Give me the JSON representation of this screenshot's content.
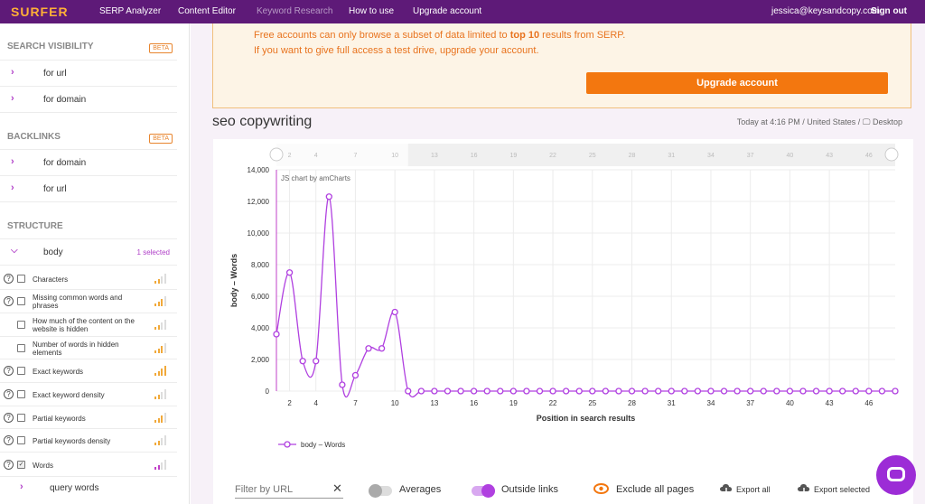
{
  "nav": {
    "logo": "SURFER",
    "items": [
      "SERP Analyzer",
      "Content Editor",
      "Keyword Research",
      "How to use",
      "Upgrade account"
    ],
    "email": "jessica@keysandcopy.com",
    "signout": "Sign out"
  },
  "sidebar": {
    "visibility": {
      "title": "SEARCH VISIBILITY",
      "badge": "BETA",
      "items": [
        "for url",
        "for domain"
      ]
    },
    "backlinks": {
      "title": "BACKLINKS",
      "badge": "BETA",
      "items": [
        "for domain",
        "for url"
      ]
    },
    "structure": {
      "title": "STRUCTURE",
      "group": "body",
      "group_count": "1 selected",
      "metrics": [
        "Characters",
        "Missing common words and phrases",
        "How much of the content on the website is hidden",
        "Number of words in hidden elements",
        "Exact keywords",
        "Exact keyword density",
        "Partial keywords",
        "Partial keywords density",
        "Words"
      ],
      "sub": "query words"
    }
  },
  "banner": {
    "line1_pre": "Free accounts can only browse a subset of data limited to ",
    "line1_bold": "top 10",
    "line1_post": " results from SERP.",
    "line2": "If you want to give full access a test drive, upgrade your account.",
    "button": "Upgrade account"
  },
  "keyword": "seo copywriting",
  "meta": "Today at 4:16 PM / United States / 🖵 Desktop",
  "chart_data": {
    "type": "line",
    "credit": "JS chart by amCharts",
    "xlabel": "Position in search results",
    "ylabel": "body – Words",
    "ylim": [
      0,
      14000
    ],
    "yticks": [
      "0",
      "2,000",
      "4,000",
      "6,000",
      "8,000",
      "10,000",
      "12,000",
      "14,000"
    ],
    "xticks": [
      "2",
      "4",
      "7",
      "10",
      "13",
      "16",
      "19",
      "22",
      "25",
      "28",
      "31",
      "34",
      "37",
      "40",
      "43",
      "46"
    ],
    "series": [
      {
        "name": "body – Words",
        "color": "#b040e0",
        "x": [
          1,
          2,
          3,
          4,
          5,
          6,
          7,
          8,
          9,
          10,
          11,
          12,
          13,
          14,
          15,
          16,
          17,
          18,
          19,
          20,
          21,
          22,
          23,
          24,
          25,
          26,
          27,
          28,
          29,
          30,
          31,
          32,
          33,
          34,
          35,
          36,
          37,
          38,
          39,
          40,
          41,
          42,
          43,
          44,
          45,
          46,
          47,
          48
        ],
        "values": [
          3600,
          7500,
          1900,
          1900,
          12300,
          400,
          1000,
          2700,
          2700,
          5000,
          0,
          0,
          0,
          0,
          0,
          0,
          0,
          0,
          0,
          0,
          0,
          0,
          0,
          0,
          0,
          0,
          0,
          0,
          0,
          0,
          0,
          0,
          0,
          0,
          0,
          0,
          0,
          0,
          0,
          0,
          0,
          0,
          0,
          0,
          0,
          0,
          0,
          0
        ]
      }
    ]
  },
  "bottom": {
    "filter_placeholder": "Filter by URL",
    "averages": "Averages",
    "outside": "Outside links",
    "exclude": "Exclude all pages",
    "export_all": "Export all",
    "export_selected": "Export selected"
  },
  "colors": {
    "nav": "#5e1a78",
    "accent": "#b040e0",
    "orange": "#f3770f",
    "logo": "#ffb037"
  }
}
